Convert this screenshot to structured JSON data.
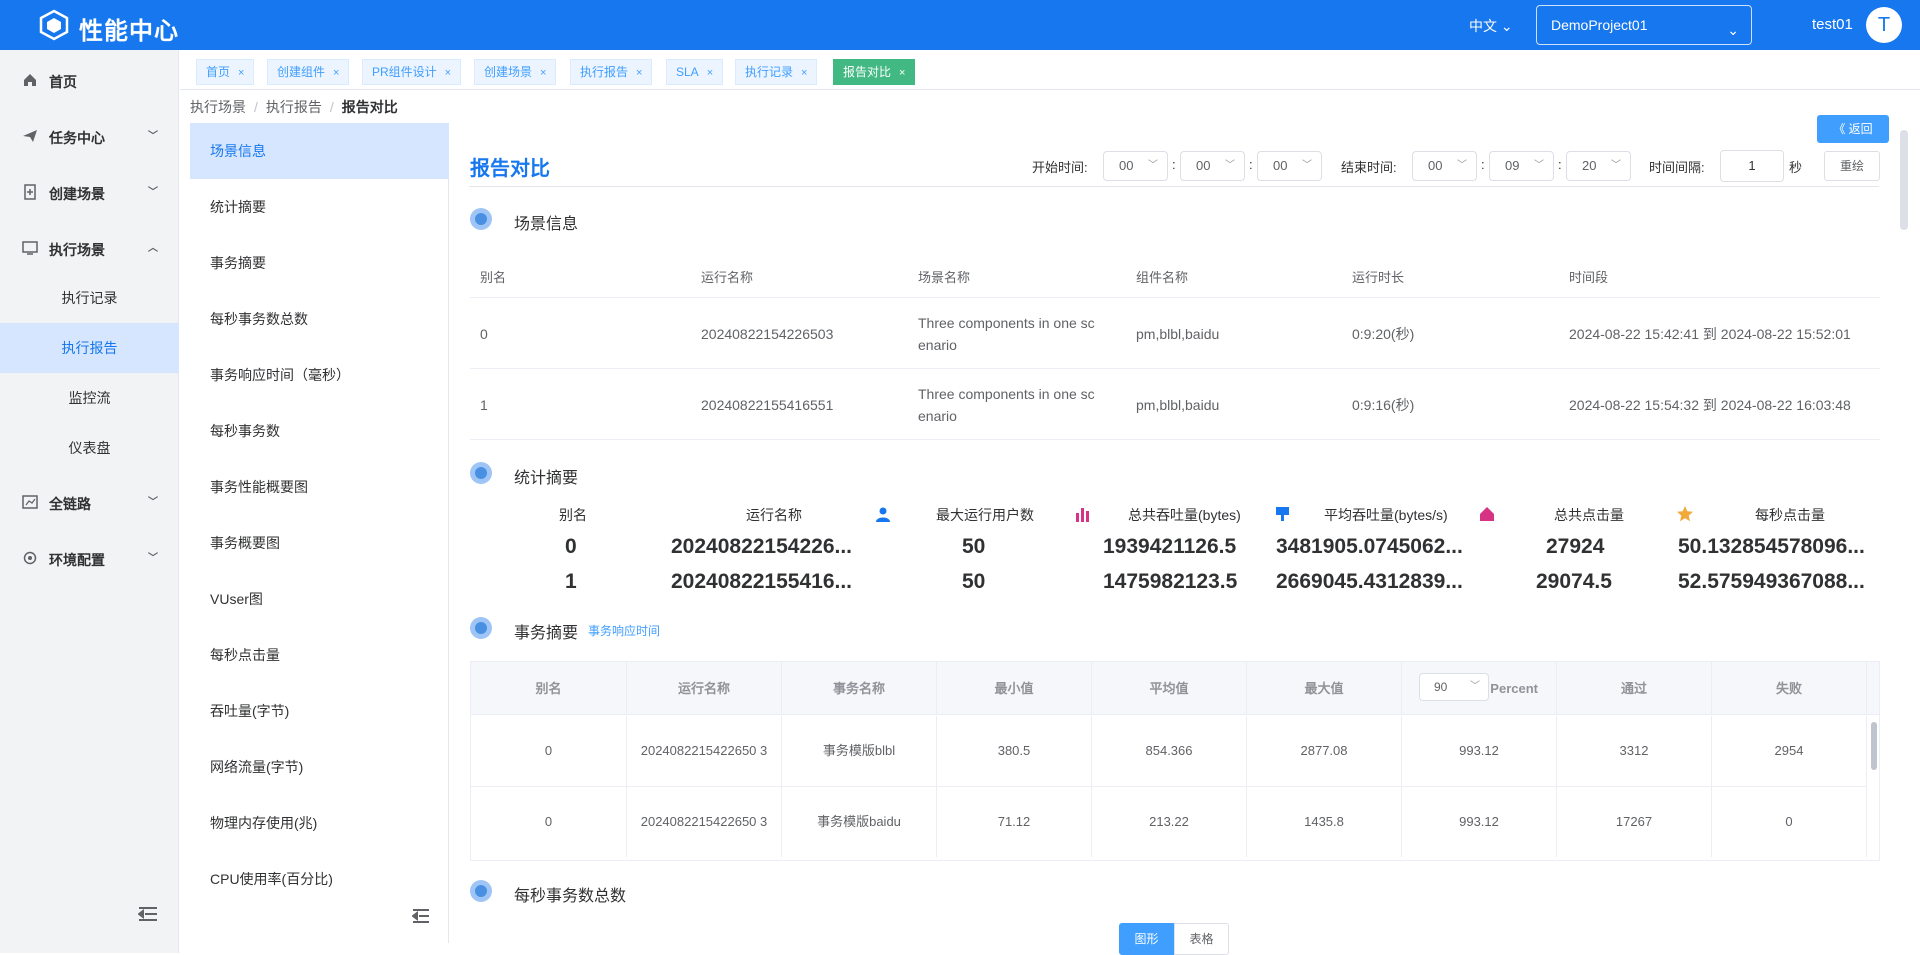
{
  "header": {
    "brand": "性能中心",
    "lang": "中文",
    "project": "DemoProject01",
    "user": "test01",
    "avatar": "T"
  },
  "sidebar": {
    "items": [
      {
        "label": "首页",
        "icon": "home-icon"
      },
      {
        "label": "任务中心",
        "icon": "send-icon"
      },
      {
        "label": "创建场景",
        "icon": "doc-plus-icon"
      },
      {
        "label": "执行场景",
        "icon": "monitor-icon"
      },
      {
        "label": "全链路",
        "icon": "chart-icon"
      },
      {
        "label": "环境配置",
        "icon": "gear-icon"
      }
    ],
    "subitems": [
      "执行记录",
      "执行报告",
      "监控流",
      "仪表盘"
    ]
  },
  "tabs": [
    "首页",
    "创建组件",
    "PR组件设计",
    "创建场景",
    "执行报告",
    "SLA",
    "执行记录",
    "报告对比"
  ],
  "breadcrumb": {
    "a": "执行场景",
    "b": "执行报告",
    "c": "报告对比"
  },
  "leftnav": [
    "场景信息",
    "统计摘要",
    "事务摘要",
    "每秒事务数总数",
    "事务响应时间（毫秒）",
    "每秒事务数",
    "事务性能概要图",
    "事务概要图",
    "VUser图",
    "每秒点击量",
    "吞吐量(字节)",
    "网络流量(字节)",
    "物理内存使用(兆)",
    "CPU使用率(百分比)"
  ],
  "main": {
    "back": "《 返回",
    "title": "报告对比",
    "start_label": "开始时间:",
    "end_label": "结束时间:",
    "start": [
      "00",
      "00",
      "00"
    ],
    "end": [
      "00",
      "09",
      "20"
    ],
    "colon": ":",
    "interval_label": "时间间隔:",
    "interval": "1",
    "unit": "秒",
    "reset": "重绘"
  },
  "scene": {
    "title": "场景信息",
    "headers": [
      "别名",
      "运行名称",
      "场景名称",
      "组件名称",
      "运行时长",
      "时间段"
    ],
    "rows": [
      [
        "0",
        "20240822154226503",
        "Three components in one sc enario",
        "pm,blbl,baidu",
        "0:9:20(秒)",
        "2024-08-22 15:42:41 到 2024-08-22 15:52:01"
      ],
      [
        "1",
        "20240822155416551",
        "Three components in one sc enario",
        "pm,blbl,baidu",
        "0:9:16(秒)",
        "2024-08-22 15:54:32 到 2024-08-22 16:03:48"
      ]
    ]
  },
  "stats": {
    "title": "统计摘要",
    "headers": [
      "别名",
      "运行名称",
      "最大运行用户数",
      "总共吞吐量(bytes)",
      "平均吞吐量(bytes/s)",
      "总共点击量",
      "每秒点击量"
    ],
    "rows": [
      [
        "0",
        "20240822154226...",
        "50",
        "1939421126.5",
        "3481905.0745062...",
        "27924",
        "50.132854578096..."
      ],
      [
        "1",
        "20240822155416...",
        "50",
        "1475982123.5",
        "2669045.4312839...",
        "29074.5",
        "52.575949367088..."
      ]
    ]
  },
  "tx": {
    "title": "事务摘要",
    "link": "事务响应时间",
    "headers": [
      "别名",
      "运行名称",
      "事务名称",
      "最小值",
      "平均值",
      "最大值",
      "Percent",
      "通过",
      "失败"
    ],
    "percent": "90",
    "rows": [
      [
        "0",
        "2024082215422650 3",
        "事务模版blbl",
        "380.5",
        "854.366",
        "2877.08",
        "993.12",
        "3312",
        "2954"
      ],
      [
        "0",
        "2024082215422650 3",
        "事务模版baidu",
        "71.12",
        "213.22",
        "1435.8",
        "993.12",
        "17267",
        "0"
      ]
    ]
  },
  "tps": {
    "title": "每秒事务数总数",
    "seg": [
      "图形",
      "表格"
    ]
  },
  "colors": {
    "primary": "#1677ee",
    "active_bg": "#d6e6ff",
    "tab_active": "#42b983"
  }
}
